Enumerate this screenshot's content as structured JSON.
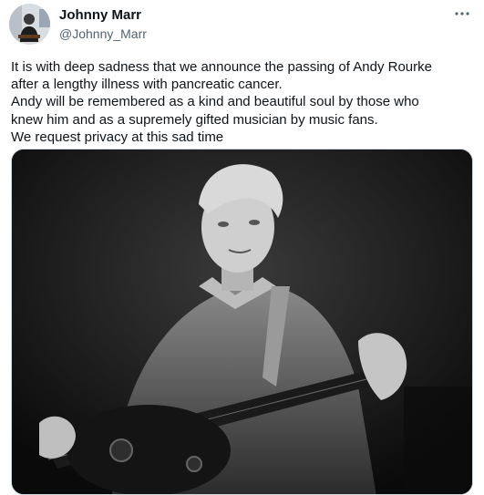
{
  "tweet": {
    "author": {
      "display_name": "Johnny Marr",
      "handle": "@Johnny_Marr"
    },
    "text_lines": [
      "It is with deep sadness that we announce the passing of Andy Rourke",
      "after a lengthy illness with pancreatic cancer.",
      "Andy will be remembered as a kind and beautiful soul by those who",
      "knew him and as a supremely gifted musician by music fans.",
      "We request privacy at this sad time"
    ],
    "icons": {
      "more": "more-options-icon"
    },
    "colors": {
      "text": "#0f1419",
      "secondary_text": "#536471",
      "media_border": "#cfd9de"
    }
  }
}
